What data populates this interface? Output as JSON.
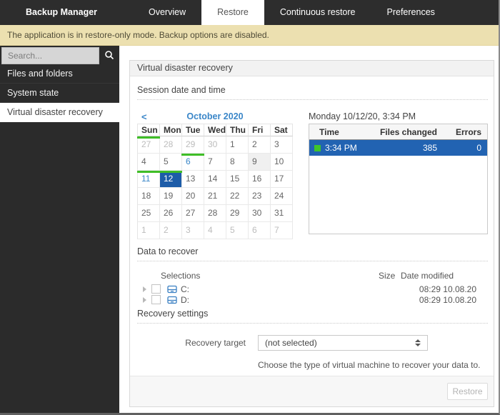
{
  "nav": {
    "brand": "Backup Manager",
    "tabs": [
      {
        "label": "Overview",
        "active": false
      },
      {
        "label": "Restore",
        "active": true
      },
      {
        "label": "Continuous restore",
        "active": false
      },
      {
        "label": "Preferences",
        "active": false
      }
    ]
  },
  "banner": {
    "text": "The application is in restore-only mode. Backup options are disabled."
  },
  "sidebar": {
    "search": {
      "placeholder": "Search...",
      "icon": "magnifier-icon"
    },
    "items": [
      {
        "label": "Files and folders",
        "selected": false
      },
      {
        "label": "System state",
        "selected": false
      },
      {
        "label": "Virtual disaster recovery",
        "selected": true
      }
    ]
  },
  "panel": {
    "title": "Virtual disaster recovery",
    "session_section": {
      "title": "Session date and time",
      "calendar": {
        "prev_icon": "<",
        "month_label": "October 2020",
        "day_headers": [
          "Sun",
          "Mon",
          "Tue",
          "Wed",
          "Thu",
          "Fri",
          "Sat"
        ],
        "cells": [
          {
            "d": "27",
            "out": true,
            "mark": true
          },
          {
            "d": "28",
            "out": true
          },
          {
            "d": "29",
            "out": true
          },
          {
            "d": "30",
            "out": true
          },
          {
            "d": "1"
          },
          {
            "d": "2"
          },
          {
            "d": "3"
          },
          {
            "d": "4"
          },
          {
            "d": "5"
          },
          {
            "d": "6",
            "link": true,
            "mark": true
          },
          {
            "d": "7"
          },
          {
            "d": "8"
          },
          {
            "d": "9",
            "shaded": true
          },
          {
            "d": "10"
          },
          {
            "d": "11",
            "link": true,
            "mark": true
          },
          {
            "d": "12",
            "selected": true,
            "mark": true
          },
          {
            "d": "13"
          },
          {
            "d": "14"
          },
          {
            "d": "15"
          },
          {
            "d": "16"
          },
          {
            "d": "17"
          },
          {
            "d": "18"
          },
          {
            "d": "19"
          },
          {
            "d": "20"
          },
          {
            "d": "21"
          },
          {
            "d": "22"
          },
          {
            "d": "23"
          },
          {
            "d": "24"
          },
          {
            "d": "25"
          },
          {
            "d": "26"
          },
          {
            "d": "27"
          },
          {
            "d": "28"
          },
          {
            "d": "29"
          },
          {
            "d": "30"
          },
          {
            "d": "31"
          },
          {
            "d": "1",
            "out": true
          },
          {
            "d": "2",
            "out": true
          },
          {
            "d": "3",
            "out": true
          },
          {
            "d": "4",
            "out": true
          },
          {
            "d": "5",
            "out": true
          },
          {
            "d": "6",
            "out": true
          },
          {
            "d": "7",
            "out": true
          }
        ]
      },
      "sessions": {
        "date_label": "Monday 10/12/20, 3:34 PM",
        "columns": [
          "Time",
          "Files changed",
          "Errors"
        ],
        "rows": [
          {
            "time": "3:34 PM",
            "files_changed": "385",
            "errors": "0",
            "selected": true,
            "status_color": "#3fc42c"
          }
        ]
      }
    },
    "recover_section": {
      "title": "Data to recover",
      "columns": [
        "Selections",
        "Size",
        "Date modified"
      ],
      "rows": [
        {
          "label": "C:",
          "size": "",
          "date_modified": "08:29 10.08.20",
          "checked": false
        },
        {
          "label": "D:",
          "size": "",
          "date_modified": "08:29 10.08.20",
          "checked": false
        }
      ]
    },
    "settings_section": {
      "title": "Recovery settings",
      "target_label": "Recovery target",
      "target_value": "(not selected)",
      "help_text": "Choose the type of virtual machine to recover your data to."
    },
    "footer": {
      "restore_label": "Restore",
      "restore_enabled": false
    }
  },
  "colors": {
    "nav_bg": "#2d2d2d",
    "sidebar_bg": "#2b2b2b",
    "banner_bg": "#ece0b0",
    "accent_blue": "#3a86c8",
    "selected_day_blue": "#1d5ca8",
    "selected_row_blue": "#2263b2",
    "session_marker_green": "#3fbe27",
    "status_green": "#3fc42c",
    "drive_icon_blue": "#3a7fc2"
  }
}
